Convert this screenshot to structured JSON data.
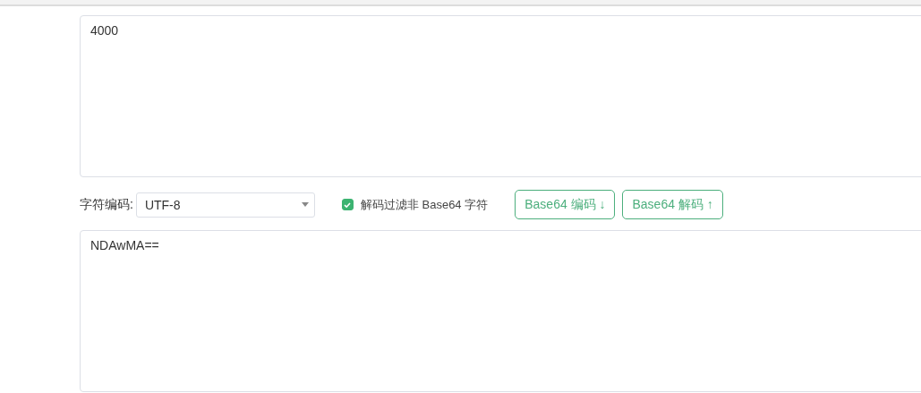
{
  "input_text": {
    "value": "4000"
  },
  "charset": {
    "label": "字符编码:",
    "value": "UTF-8"
  },
  "filter_option": {
    "label": "解码过滤非 Base64 字符",
    "checked": true
  },
  "buttons": [
    {
      "label": "Base64 编码 ↓"
    },
    {
      "label": "Base64 解码 ↑"
    }
  ],
  "output_text": {
    "value": "NDAwMA=="
  }
}
